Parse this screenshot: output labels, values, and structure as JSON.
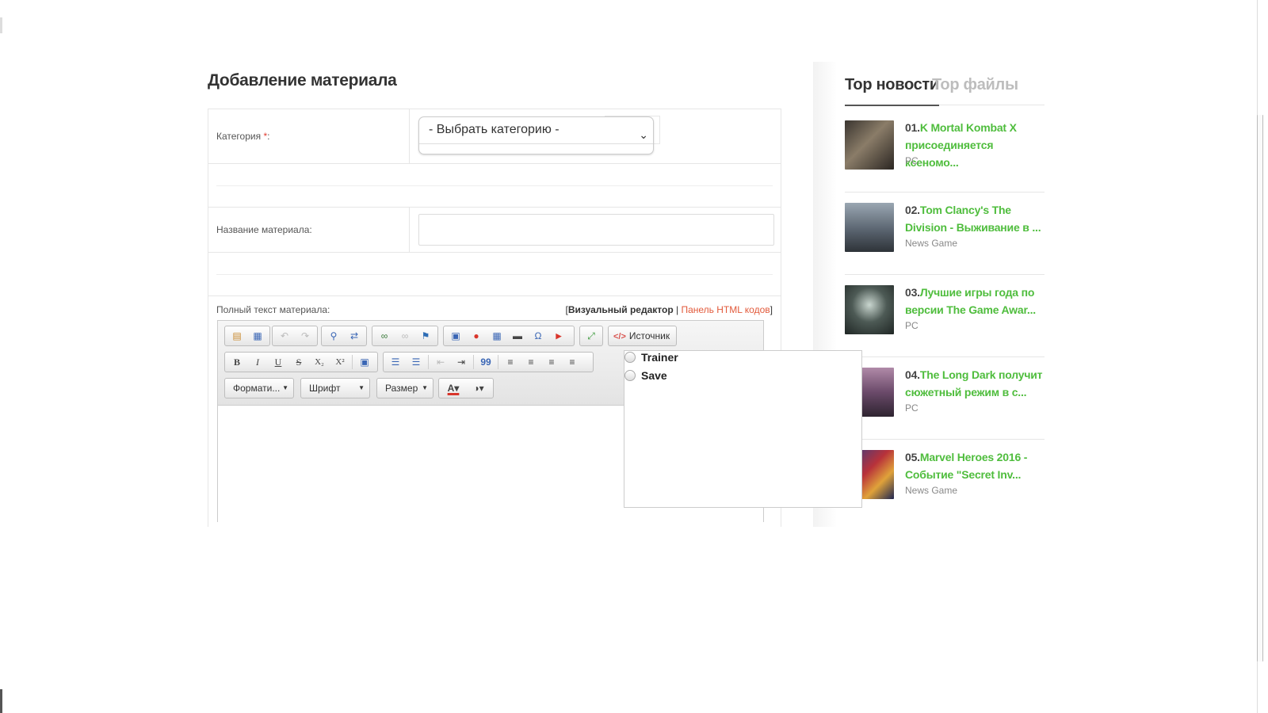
{
  "page": {
    "title": "Добавление материала"
  },
  "form": {
    "category_label": "Категория ",
    "category_required": "*",
    "category_colon": ":",
    "category_selected": "- Выбрать категорию -",
    "name_label": "Название материала:",
    "name_value": "",
    "fulltext_label": "Полный текст материала:",
    "mode_open": "[",
    "mode_visual": "Визуальный редактор",
    "mode_divider": " | ",
    "mode_html": "Панель HTML кодов",
    "mode_close": "]"
  },
  "editor": {
    "source_label": "Источник",
    "format_label": "Формати...",
    "font_label": "Шрифт",
    "size_label": "Размер",
    "icons": [
      "template-icon",
      "paste-word-icon",
      "undo-icon",
      "redo-icon",
      "find-icon",
      "replace-icon",
      "link-icon",
      "unlink-icon",
      "anchor-icon",
      "image-icon",
      "flash-icon",
      "table-icon",
      "horizontal-rule-icon",
      "special-char-icon",
      "youtube-icon",
      "maximize-icon",
      "bold-icon",
      "italic-icon",
      "underline-icon",
      "strike-icon",
      "subscript-icon",
      "superscript-icon",
      "remove-format-icon",
      "numbered-list-icon",
      "bulleted-list-icon",
      "outdent-icon",
      "indent-icon",
      "blockquote-icon",
      "align-left-icon",
      "align-center-icon",
      "align-right-icon",
      "justify-icon",
      "text-color-icon",
      "bg-color-icon"
    ],
    "glyphs": {
      "bold": "B",
      "italic": "I",
      "underline": "U",
      "strike": "S",
      "sub": "X₂",
      "sup": "X²",
      "omega": "Ω",
      "quote": "99"
    }
  },
  "popup": {
    "options": [
      "Trainer",
      "Save"
    ]
  },
  "sidebar": {
    "tabs": [
      "Top новости",
      "Top файлы"
    ],
    "news": [
      {
        "num": "01.",
        "title": "K Mortal Kombat X присоединяется ксеномо...",
        "category": "PC"
      },
      {
        "num": "02.",
        "title": "Tom Clancy's The Division - Выживание в ...",
        "category": "News Game"
      },
      {
        "num": "03.",
        "title": "Лучшие игры года по версии The Game Awar...",
        "category": "PC"
      },
      {
        "num": "04.",
        "title": "The Long Dark получит сюжетный режим в с...",
        "category": "PC"
      },
      {
        "num": "05.",
        "title": "Marvel Heroes 2016 - Событие \"Secret Inv...",
        "category": "News Game"
      }
    ]
  },
  "colors": {
    "accent_green": "#4fbd3d",
    "html_link": "#e25a3b",
    "required": "#e03c31"
  }
}
